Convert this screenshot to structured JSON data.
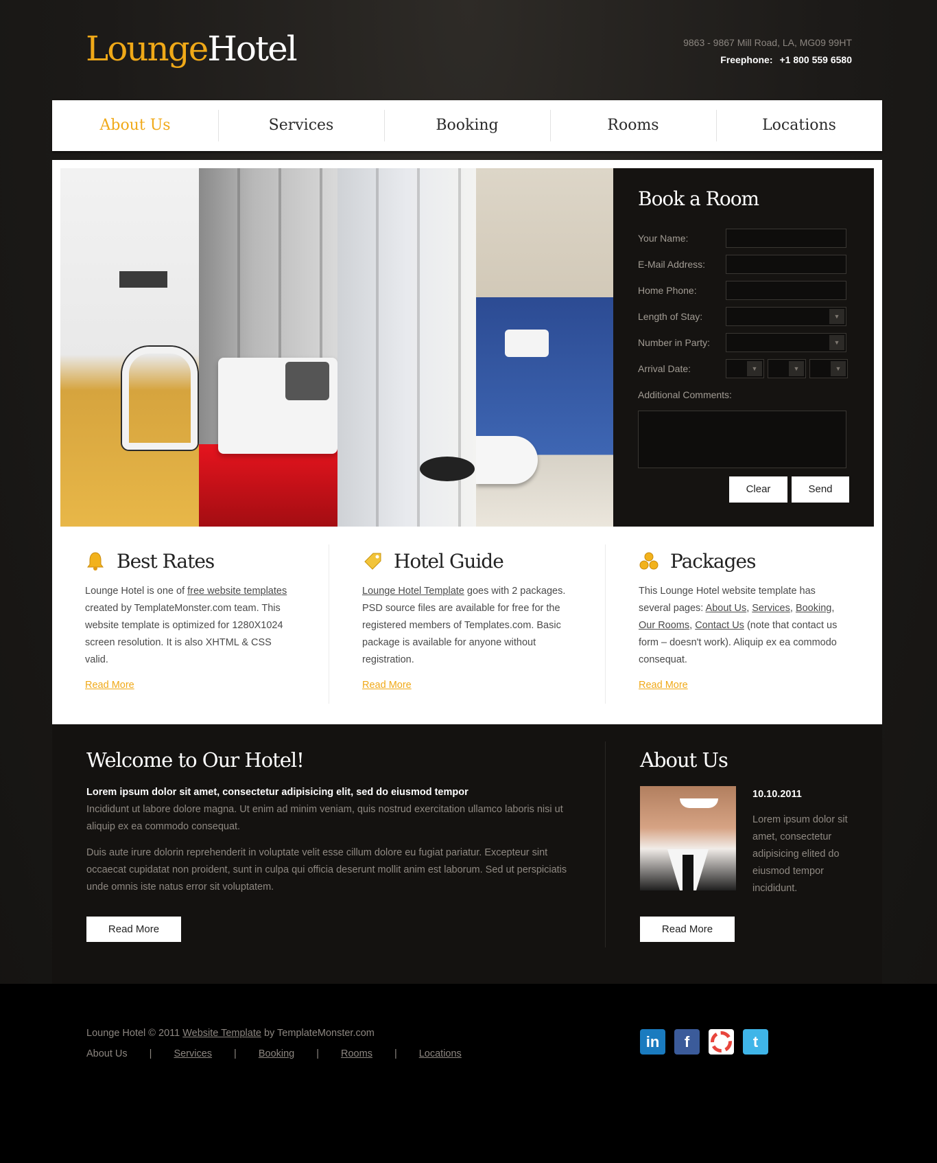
{
  "header": {
    "logo_part1": "Lounge",
    "logo_part2": "Hotel",
    "address": "9863 - 9867 Mill Road, LA, MG09 99HT",
    "phone_label": "Freephone:",
    "phone": "+1 800 559 6580"
  },
  "nav": [
    {
      "label": "About Us",
      "active": true
    },
    {
      "label": "Services"
    },
    {
      "label": "Booking"
    },
    {
      "label": "Rooms"
    },
    {
      "label": "Locations"
    }
  ],
  "booking": {
    "title": "Book a Room",
    "labels": {
      "name": "Your Name:",
      "email": "E-Mail Address:",
      "phone": "Home Phone:",
      "stay": "Length of Stay:",
      "party": "Number in Party:",
      "arrival": "Arrival Date:",
      "comments": "Additional Comments:"
    },
    "clear_label": "Clear",
    "send_label": "Send"
  },
  "columns": [
    {
      "title": "Best Rates",
      "icon": "bell-icon",
      "text_before": "Lounge Hotel is one of ",
      "link": "free website templates",
      "text_after": " created by TemplateMonster.com team. This website template is optimized for 1280X1024 screen resolution. It is also XHTML & CSS valid.",
      "more": "Read More"
    },
    {
      "title": "Hotel Guide",
      "icon": "tag-icon",
      "link": "Lounge Hotel Template",
      "text_after": " goes with 2 packages. PSD source files are available for free for the registered members of Templates.com. Basic package is available for anyone without registration.",
      "more": "Read More"
    },
    {
      "title": "Packages",
      "icon": "packages-icon",
      "text_before": "This Lounge Hotel website template has several pages: ",
      "links": [
        "About Us",
        "Services",
        "Booking",
        "Our Rooms",
        "Contact Us"
      ],
      "text_after": " (note that contact us form – doesn't work). Aliquip ex ea commodo consequat.",
      "more": "Read More"
    }
  ],
  "welcome": {
    "title": "Welcome to Our Hotel!",
    "lead": "Lorem ipsum dolor sit amet, consectetur adipisicing elit, sed do eiusmod tempor",
    "p1": "Incididunt ut labore dolore magna. Ut enim ad minim veniam, quis nostrud exercitation ullamco laboris nisi ut aliquip ex ea commodo consequat.",
    "p2": "Duis aute irure dolorin reprehenderit in voluptate velit esse cillum dolore eu fugiat pariatur. Excepteur sint occaecat cupidatat non proident, sunt in culpa qui officia deserunt mollit anim est laborum. Sed ut perspiciatis unde omnis iste natus error sit voluptatem.",
    "button": "Read More"
  },
  "about": {
    "title": "About Us",
    "date": "10.10.2011",
    "text": "Lorem ipsum dolor sit amet, consectetur adipisicing elited do eiusmod tempor incididunt.",
    "button": "Read More"
  },
  "footer": {
    "copy_before": "Lounge Hotel © 2011 ",
    "copy_link": "Website Template",
    "copy_after": " by TemplateMonster.com",
    "nav": [
      "About Us",
      "Services",
      "Booking",
      "Rooms",
      "Locations"
    ],
    "separator": "|",
    "social": [
      {
        "icon": "linkedin-icon",
        "glyph": "in",
        "color": "#1a7bbf"
      },
      {
        "icon": "facebook-icon",
        "glyph": "f",
        "color": "#3b5b9a"
      },
      {
        "icon": "picasa-icon",
        "glyph": "",
        "color": "#ffffff"
      },
      {
        "icon": "twitter-icon",
        "glyph": "t",
        "color": "#3fb5e8"
      }
    ]
  },
  "colors": {
    "accent": "#f0a918",
    "dark": "#141210",
    "panel": "#ffffff"
  }
}
